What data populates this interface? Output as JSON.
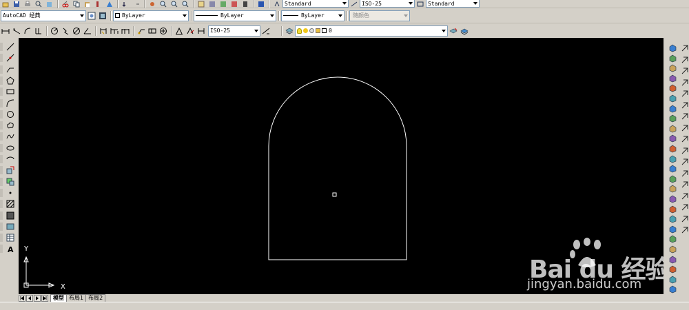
{
  "toolbar1": {
    "text_style": "Standard",
    "dim_style": "ISO-25",
    "table_style": "Standard"
  },
  "toolbar2": {
    "workspace": "AutoCAD 经典",
    "color": "ByLayer",
    "linetype": "ByLayer",
    "lineweight": "ByLayer",
    "plot_style": "随颜色"
  },
  "toolbar3": {
    "dim_style": "ISO-25",
    "layer_name": "0"
  },
  "canvas": {
    "background": "#000000",
    "ucs_y_label": "Y",
    "ucs_x_label": "X",
    "shape": "arch: semicircular top (center 490,212 r 100) with vertical sides to a base at y 377"
  },
  "tabs": [
    "模型",
    "布局1",
    "布局2"
  ],
  "watermark": {
    "logo": "Bai du 经验",
    "url": "jingyan.baidu.com"
  }
}
